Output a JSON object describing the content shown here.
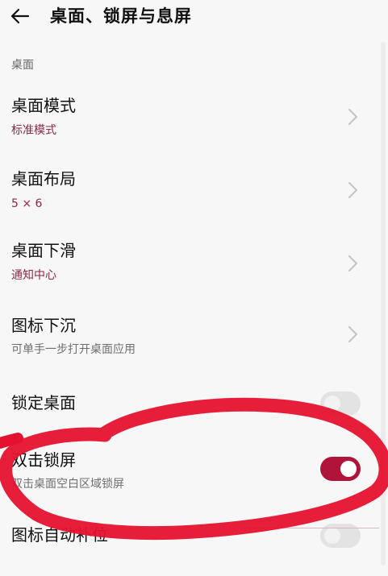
{
  "header": {
    "back_icon": "arrow-left-icon",
    "title": "桌面、锁屏与息屏"
  },
  "section": {
    "label": "桌面"
  },
  "items": [
    {
      "title": "桌面模式",
      "subtitle": "标准模式",
      "control": "chevron"
    },
    {
      "title": "桌面布局",
      "subtitle": "5 × 6",
      "control": "chevron"
    },
    {
      "title": "桌面下滑",
      "subtitle": "通知中心",
      "control": "chevron"
    },
    {
      "title": "图标下沉",
      "subtitle": "可单手一步打开桌面应用",
      "control": "chevron"
    },
    {
      "title": "锁定桌面",
      "subtitle": "",
      "control": "toggle",
      "on": false
    },
    {
      "title": "双击锁屏",
      "subtitle": "双击桌面空白区域锁屏",
      "control": "toggle",
      "on": true
    },
    {
      "title": "图标自动补位",
      "subtitle": "",
      "control": "toggle",
      "on": false
    }
  ],
  "colors": {
    "accent": "#8d2846",
    "toggle_on": "#b0143a",
    "annotation": "#e5122f"
  }
}
